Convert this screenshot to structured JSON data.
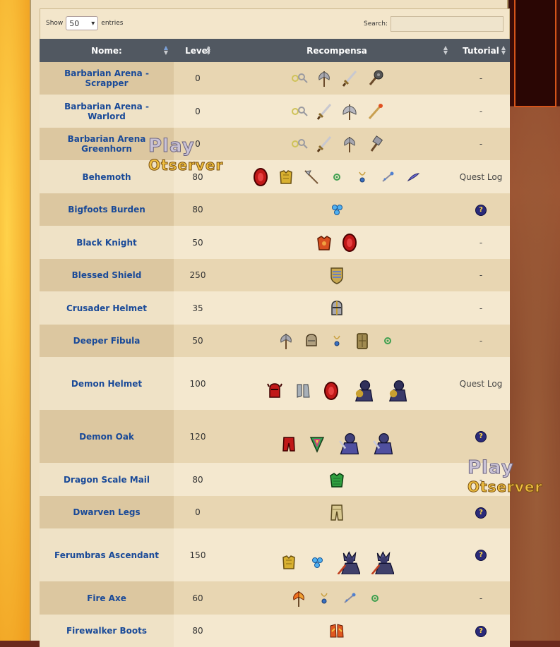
{
  "controls": {
    "show_label": "Show",
    "entries_value": "50",
    "entries_label": "entries",
    "search_label": "Search:",
    "search_value": ""
  },
  "table": {
    "columns": [
      "Nome:",
      "Level",
      "Recompensa",
      "Tutorial"
    ],
    "rows": [
      {
        "name": "Barbarian Arena - Scrapper",
        "level": "0",
        "items": [
          "keys-icon",
          "axe-icon",
          "sword-icon",
          "mace-icon"
        ],
        "tutorial": "-"
      },
      {
        "name": "Barbarian Arena - Warlord",
        "level": "0",
        "items": [
          "keys-icon",
          "sword-icon",
          "double-axe-icon",
          "rod-icon"
        ],
        "tutorial": "-"
      },
      {
        "name": "Barbarian Arena Greenhorn",
        "level": "0",
        "items": [
          "keys-icon",
          "sword-icon",
          "axe-icon",
          "hammer-icon"
        ],
        "tutorial": "-"
      },
      {
        "name": "Behemoth",
        "level": "80",
        "items": [
          "red-shield-icon",
          "golden-armor-icon",
          "halberd-icon",
          "ring-icon",
          "amulet-icon",
          "wand-icon",
          "feather-icon"
        ],
        "tutorial": "Quest Log"
      },
      {
        "name": "Bigfoots Burden",
        "level": "80",
        "items": [
          "blue-gems-icon"
        ],
        "tutorial": "?"
      },
      {
        "name": "Black Knight",
        "level": "50",
        "items": [
          "red-armor-icon",
          "red-shield-icon"
        ],
        "tutorial": "-"
      },
      {
        "name": "Blessed Shield",
        "level": "250",
        "items": [
          "blessed-shield-icon"
        ],
        "tutorial": "-"
      },
      {
        "name": "Crusader Helmet",
        "level": "35",
        "items": [
          "crusader-helmet-icon"
        ],
        "tutorial": "-"
      },
      {
        "name": "Deeper Fibula",
        "level": "50",
        "items": [
          "axe-icon",
          "helmet-icon",
          "amulet-icon",
          "tower-shield-icon",
          "ring-icon"
        ],
        "tutorial": "-"
      },
      {
        "name": "Demon Helmet",
        "level": "100",
        "items": [
          "demon-helmet-icon",
          "steel-boots-icon",
          "red-shield-icon",
          "demon-outfit-icon",
          "demon-outfit-icon"
        ],
        "tutorial": "Quest Log"
      },
      {
        "name": "Demon Oak",
        "level": "120",
        "items": [
          "red-legs-icon",
          "rainbow-shield-icon",
          "oak-outfit-icon",
          "oak-outfit-icon"
        ],
        "tutorial": "?"
      },
      {
        "name": "Dragon Scale Mail",
        "level": "80",
        "items": [
          "dragon-scale-mail-icon"
        ],
        "tutorial": "-"
      },
      {
        "name": "Dwarven Legs",
        "level": "0",
        "items": [
          "dwarven-legs-icon"
        ],
        "tutorial": "?"
      },
      {
        "name": "Ferumbras Ascendant",
        "level": "150",
        "items": [
          "golden-armor-icon",
          "blue-gems-icon",
          "ferumbras-outfit-icon",
          "ferumbras-outfit-icon"
        ],
        "tutorial": "?"
      },
      {
        "name": "Fire Axe",
        "level": "60",
        "items": [
          "fire-axe-icon",
          "amulet-icon",
          "wand-icon",
          "ring-icon"
        ],
        "tutorial": "-"
      },
      {
        "name": "Firewalker Boots",
        "level": "80",
        "items": [
          "firewalker-boots-icon"
        ],
        "tutorial": "?"
      }
    ]
  },
  "watermark": {
    "top": "Play",
    "bottom": "Otserver"
  },
  "colors": {
    "header_bg": "#515861",
    "name_link": "#1a4a98",
    "row_odd": "#e8d6b2",
    "row_even": "#f4e8cf"
  }
}
